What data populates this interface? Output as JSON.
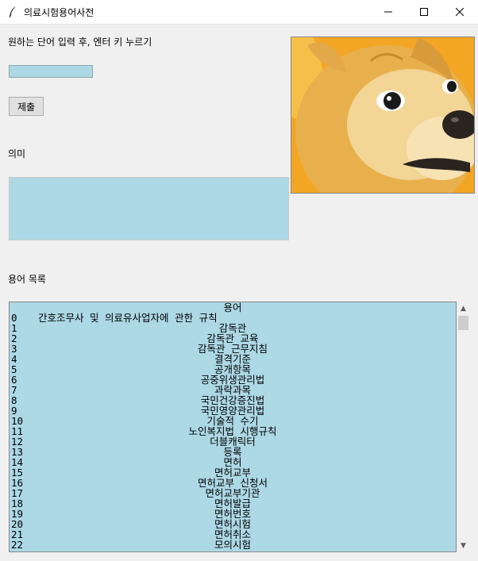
{
  "window": {
    "title": "의료시험용어사전"
  },
  "prompt": {
    "label": "원하는 단어 입력 후, 엔터 키 누르기"
  },
  "search": {
    "value": ""
  },
  "submit": {
    "label": "제출"
  },
  "meaning": {
    "label": "의미",
    "value": ""
  },
  "terms": {
    "label": "용어 목록",
    "header": "용어",
    "rows": [
      {
        "idx": "0",
        "term": "간호조무사 및 의료유사업자에 관한 규칙"
      },
      {
        "idx": "1",
        "term": "감독관"
      },
      {
        "idx": "2",
        "term": "감독관 교육"
      },
      {
        "idx": "3",
        "term": "감독관 근무지침"
      },
      {
        "idx": "4",
        "term": "결격기준"
      },
      {
        "idx": "5",
        "term": "공개항목"
      },
      {
        "idx": "6",
        "term": "공중위생관리법"
      },
      {
        "idx": "7",
        "term": "과락과목"
      },
      {
        "idx": "8",
        "term": "국민건강증진법"
      },
      {
        "idx": "9",
        "term": "국민영양관리법"
      },
      {
        "idx": "10",
        "term": "기술적 수기"
      },
      {
        "idx": "11",
        "term": "노인복지법 시행규칙"
      },
      {
        "idx": "12",
        "term": "더블캐릭터"
      },
      {
        "idx": "13",
        "term": "등록"
      },
      {
        "idx": "14",
        "term": "면허"
      },
      {
        "idx": "15",
        "term": "면허교부"
      },
      {
        "idx": "16",
        "term": "면허교부 신청서"
      },
      {
        "idx": "17",
        "term": "면허교부기관"
      },
      {
        "idx": "18",
        "term": "면허발급"
      },
      {
        "idx": "19",
        "term": "면허번호"
      },
      {
        "idx": "20",
        "term": "면허시험"
      },
      {
        "idx": "21",
        "term": "면허취소"
      },
      {
        "idx": "22",
        "term": "모의시험"
      }
    ]
  },
  "image": {
    "subject": "doge-dog-photo"
  },
  "colors": {
    "field_bg": "#add8e6",
    "window_bg": "#f0f0f0"
  }
}
